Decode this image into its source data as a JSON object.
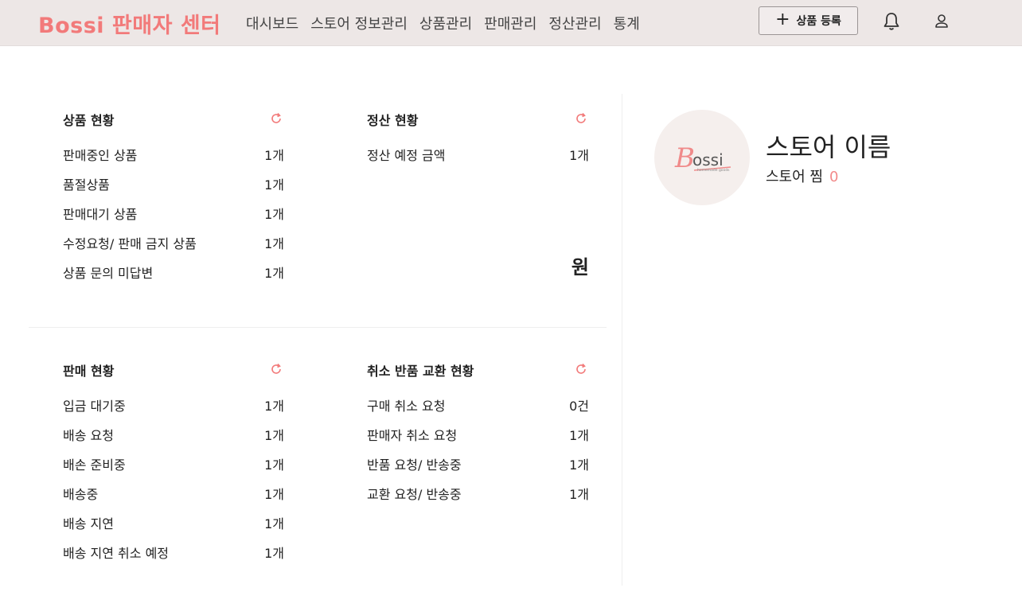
{
  "header": {
    "brand": "Bossi 판매자 센터",
    "nav": [
      "대시보드",
      "스토어 정보관리",
      "상품관리",
      "판매관리",
      "정산관리",
      "통계"
    ],
    "register_button": "상품 등록",
    "icons": [
      "plus-icon",
      "bell-icon",
      "user-icon"
    ]
  },
  "colors": {
    "accent": "#f27a7a",
    "header_bg": "#ede7e6"
  },
  "product_status": {
    "title": "상품 현황",
    "rows": [
      {
        "label": "판매중인 상품",
        "value": "1개"
      },
      {
        "label": "품절상품",
        "value": "1개"
      },
      {
        "label": "판매대기 상품",
        "value": "1개"
      },
      {
        "label": "수정요청/ 판매 금지 상품",
        "value": "1개"
      },
      {
        "label": "상품 문의 미답변",
        "value": "1개"
      }
    ]
  },
  "settlement_status": {
    "title": "정산 현황",
    "rows": [
      {
        "label": "정산 예정 금액",
        "value": "1개"
      }
    ],
    "total_unit": "원"
  },
  "sales_status": {
    "title": "판매 현황",
    "rows": [
      {
        "label": "입금 대기중",
        "value": "1개"
      },
      {
        "label": "배송 요청",
        "value": "1개"
      },
      {
        "label": "배손 준비중",
        "value": "1개"
      },
      {
        "label": "배송중",
        "value": "1개"
      },
      {
        "label": "배송 지연",
        "value": "1개"
      },
      {
        "label": "배송 지연 취소 예정",
        "value": "1개"
      }
    ]
  },
  "cancel_status": {
    "title": "취소 반품 교환 현황",
    "rows": [
      {
        "label": "구매 취소 요청",
        "value": "0건"
      },
      {
        "label": "판매자 취소 요청",
        "value": "1개"
      },
      {
        "label": "반품 요청/ 반송중",
        "value": "1개"
      },
      {
        "label": "교환 요청/ 반송중",
        "value": "1개"
      }
    ]
  },
  "store": {
    "logo_text": "Bossi",
    "logo_sub": "homemade goods",
    "name": "스토어 이름",
    "like_label": "스토어 찜",
    "like_count": "0"
  }
}
